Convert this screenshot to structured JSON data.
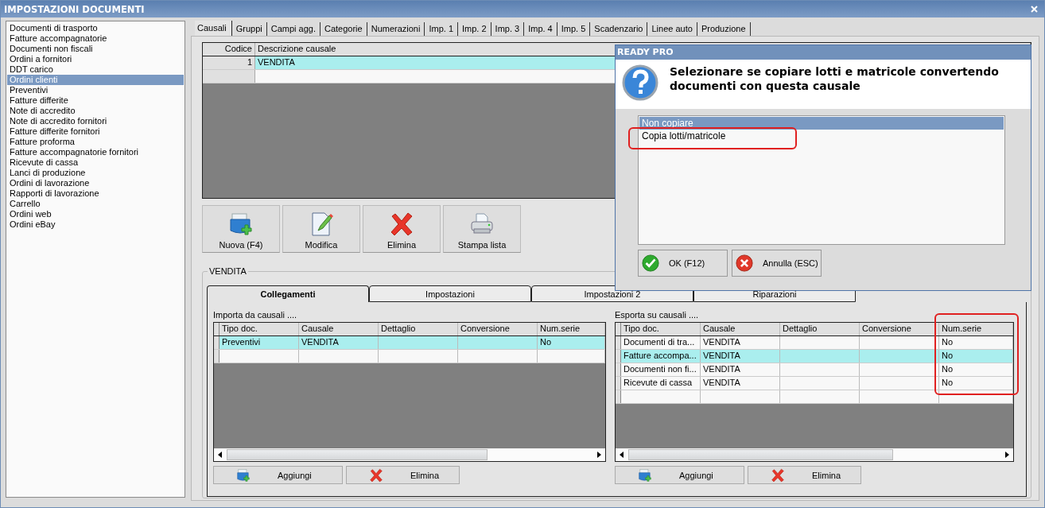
{
  "window": {
    "title": "IMPOSTAZIONI DOCUMENTI"
  },
  "sidebar": {
    "items": [
      {
        "label": "Documenti di trasporto",
        "selected": false
      },
      {
        "label": "Fatture accompagnatorie",
        "selected": false
      },
      {
        "label": "Documenti non fiscali",
        "selected": false
      },
      {
        "label": "Ordini a fornitori",
        "selected": false
      },
      {
        "label": "DDT carico",
        "selected": false
      },
      {
        "label": "Ordini clienti",
        "selected": true
      },
      {
        "label": "Preventivi",
        "selected": false
      },
      {
        "label": "Fatture differite",
        "selected": false
      },
      {
        "label": "Note di accredito",
        "selected": false
      },
      {
        "label": "Note di accredito fornitori",
        "selected": false
      },
      {
        "label": "Fatture differite fornitori",
        "selected": false
      },
      {
        "label": "Fatture proforma",
        "selected": false
      },
      {
        "label": "Fatture accompagnatorie fornitori",
        "selected": false
      },
      {
        "label": "Ricevute di cassa",
        "selected": false
      },
      {
        "label": "Lanci di produzione",
        "selected": false
      },
      {
        "label": "Ordini di lavorazione",
        "selected": false
      },
      {
        "label": "Rapporti di lavorazione",
        "selected": false
      },
      {
        "label": "Carrello",
        "selected": false
      },
      {
        "label": "Ordini web",
        "selected": false
      },
      {
        "label": "Ordini eBay",
        "selected": false
      }
    ]
  },
  "tabs": [
    {
      "label": "Causali",
      "selected": true
    },
    {
      "label": "Gruppi",
      "selected": false
    },
    {
      "label": "Campi agg.",
      "selected": false
    },
    {
      "label": "Categorie",
      "selected": false
    },
    {
      "label": "Numerazioni",
      "selected": false
    },
    {
      "label": "Imp. 1",
      "selected": false
    },
    {
      "label": "Imp. 2",
      "selected": false
    },
    {
      "label": "Imp. 3",
      "selected": false
    },
    {
      "label": "Imp. 4",
      "selected": false
    },
    {
      "label": "Imp. 5",
      "selected": false
    },
    {
      "label": "Scadenzario",
      "selected": false
    },
    {
      "label": "Linee auto",
      "selected": false
    },
    {
      "label": "Produzione",
      "selected": false
    }
  ],
  "causali_table": {
    "columns": [
      "Codice",
      "Descrizione causale"
    ],
    "rows": [
      {
        "cells": [
          "1",
          "VENDITA"
        ],
        "selected": true
      }
    ]
  },
  "toolbar": [
    {
      "label": "Nuova (F4)",
      "kind": "add"
    },
    {
      "label": "Modifica",
      "kind": "edit"
    },
    {
      "label": "Elimina",
      "kind": "delete"
    },
    {
      "label": "Stampa lista",
      "kind": "print"
    }
  ],
  "group": {
    "title": "VENDITA",
    "tabs": [
      {
        "label": "Collegamenti",
        "selected": true
      },
      {
        "label": "Impostazioni",
        "selected": false
      },
      {
        "label": "Impostazioni 2",
        "selected": false
      },
      {
        "label": "Riparazioni",
        "selected": false
      }
    ],
    "panels": [
      {
        "label": "Importa da causali ....",
        "columns": [
          "Tipo doc.",
          "Causale",
          "Dettaglio",
          "Conversione",
          "Num.serie"
        ],
        "rows": [
          {
            "cells": [
              "Preventivi",
              "VENDITA",
              "",
              "",
              "No"
            ],
            "selected": true
          }
        ],
        "buttons": [
          {
            "label": "Aggiungi",
            "kind": "add"
          },
          {
            "label": "Elimina",
            "kind": "delete"
          }
        ]
      },
      {
        "label": "Esporta su causali ....",
        "columns": [
          "Tipo doc.",
          "Causale",
          "Dettaglio",
          "Conversione",
          "Num.serie"
        ],
        "rows": [
          {
            "cells": [
              "Documenti di tra...",
              "VENDITA",
              "",
              "",
              "No"
            ],
            "selected": false
          },
          {
            "cells": [
              "Fatture accompa...",
              "VENDITA",
              "",
              "",
              "No"
            ],
            "selected": true
          },
          {
            "cells": [
              "Documenti non fi...",
              "VENDITA",
              "",
              "",
              "No"
            ],
            "selected": false
          },
          {
            "cells": [
              "Ricevute di cassa",
              "VENDITA",
              "",
              "",
              "No"
            ],
            "selected": false
          }
        ],
        "buttons": [
          {
            "label": "Aggiungi",
            "kind": "add"
          },
          {
            "label": "Elimina",
            "kind": "delete"
          }
        ]
      }
    ]
  },
  "dialog": {
    "title": "READY PRO",
    "message": "Selezionare se copiare lotti e matricole convertendo documenti con questa causale",
    "options": [
      {
        "label": "Non copiare",
        "selected": true
      },
      {
        "label": "Copia lotti/matricole",
        "selected": false
      }
    ],
    "buttons": [
      {
        "label": "OK (F12)",
        "kind": "ok"
      },
      {
        "label": "Annulla (ESC)",
        "kind": "cancel"
      }
    ]
  }
}
